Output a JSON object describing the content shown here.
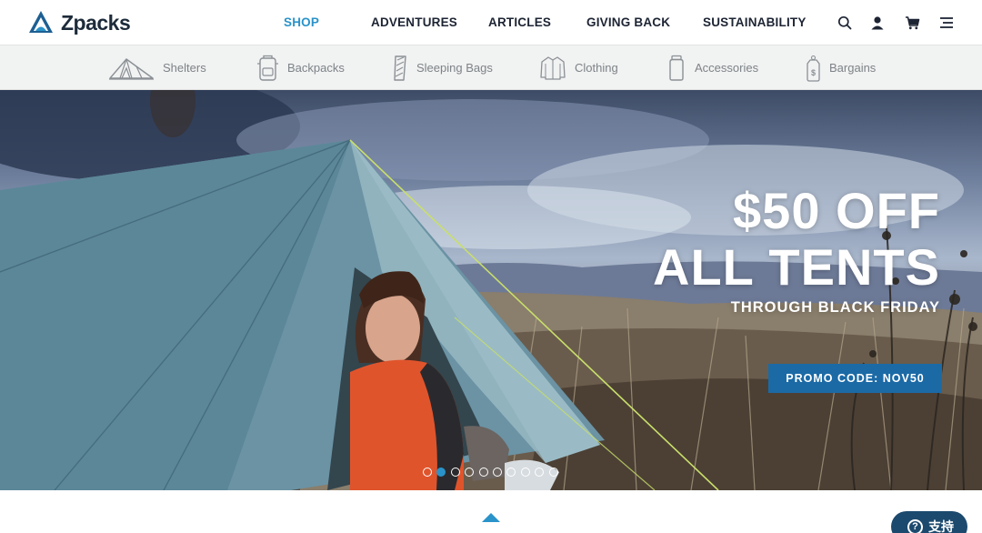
{
  "brand": {
    "name": "Zpacks",
    "accent": "#2a93c9",
    "dark": "#1d2b3a"
  },
  "nav": {
    "items": [
      {
        "label": "SHOP",
        "active": true
      },
      {
        "label": "ADVENTURES",
        "active": false
      },
      {
        "label": "ARTICLES",
        "active": false
      },
      {
        "label": "GIVING BACK",
        "active": false
      },
      {
        "label": "SUSTAINABILITY",
        "active": false
      }
    ],
    "icons": [
      "search-icon",
      "account-icon",
      "cart-icon",
      "menu-icon"
    ]
  },
  "categories": [
    {
      "label": "Shelters",
      "icon": "tent-icon"
    },
    {
      "label": "Backpacks",
      "icon": "backpack-icon"
    },
    {
      "label": "Sleeping Bags",
      "icon": "sleeping-bag-icon"
    },
    {
      "label": "Clothing",
      "icon": "jacket-icon"
    },
    {
      "label": "Accessories",
      "icon": "bottle-icon"
    },
    {
      "label": "Bargains",
      "icon": "tag-icon"
    }
  ],
  "hero": {
    "line1": "$50 OFF",
    "line2": "ALL TENTS",
    "sub": "THROUGH BLACK FRIDAY",
    "promo_label": "PROMO CODE: NOV50",
    "promo_color": "#1b6aa6",
    "slides_total": 10,
    "slide_active": 2
  },
  "support": {
    "label": "支持",
    "icon": "help-icon",
    "color": "#1c4a6e"
  }
}
